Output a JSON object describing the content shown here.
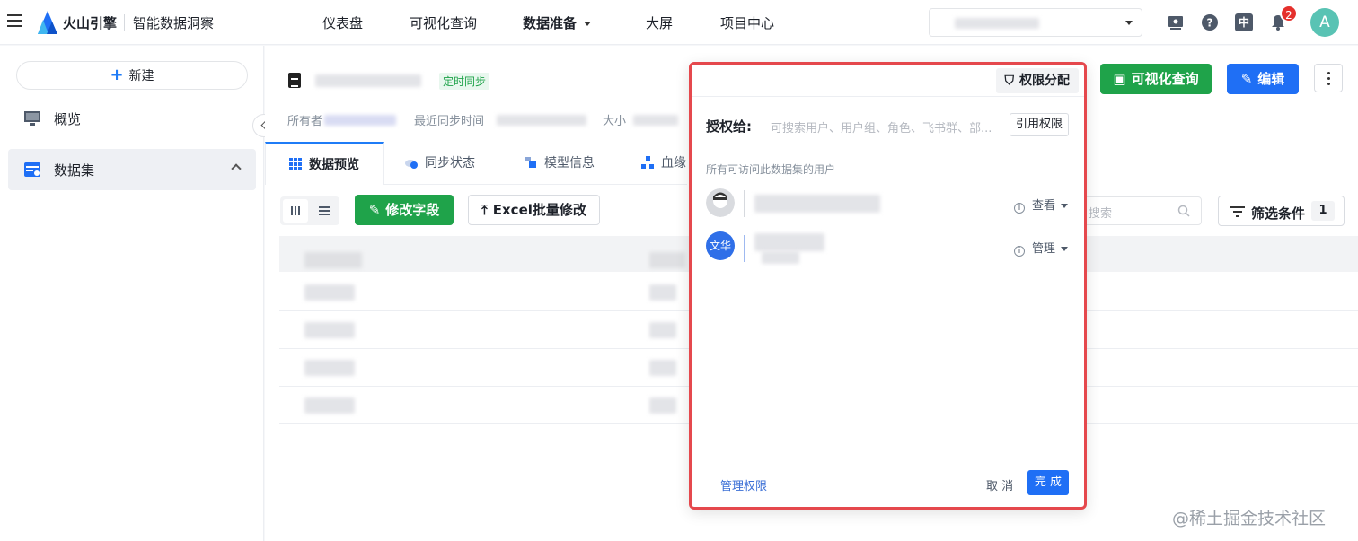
{
  "header": {
    "brand": "火山引擎",
    "product": "智能数据洞察",
    "nav": [
      {
        "label": "仪表盘"
      },
      {
        "label": "可视化查询"
      },
      {
        "label": "数据准备"
      },
      {
        "label": "大屏"
      },
      {
        "label": "项目中心"
      }
    ],
    "notification_count": "2",
    "language": "中",
    "avatar_letter": "A"
  },
  "sidebar": {
    "new_label": "新建",
    "items": [
      {
        "label": "概览"
      },
      {
        "label": "数据集"
      }
    ]
  },
  "dataset": {
    "sync_tag": "定时同步",
    "meta_owner_label": "所有者",
    "meta_last_sync_label": "最近同步时间",
    "meta_size_label": "大小"
  },
  "tabs": [
    {
      "label": "数据预览"
    },
    {
      "label": "同步状态"
    },
    {
      "label": "模型信息"
    },
    {
      "label": "血缘"
    }
  ],
  "toolbar": {
    "edit_fields": "修改字段",
    "excel_batch": "Excel批量修改",
    "search_placeholder": "搜索",
    "filter_label": "筛选条件",
    "filter_count": "1",
    "visual_query_btn": "可视化查询",
    "edit_btn": "编辑"
  },
  "modal": {
    "title_tag": "权限分配",
    "grant_label": "授权给:",
    "grant_placeholder": "可搜索用户、用户组、角色、飞书群、部...",
    "quote_btn": "引用权限",
    "users_title": "所有可访问此数据集的用户",
    "users": [
      {
        "role": "查看"
      },
      {
        "avatar_text": "文华",
        "role": "管理"
      }
    ],
    "manage_link": "管理权限",
    "cancel": "取 消",
    "done": "完 成"
  },
  "watermark": "@稀土掘金技术社区",
  "colors": {
    "accent_blue": "#1f6ff5",
    "green": "#1fa34a",
    "highlight_red": "#e5484d",
    "badge_red": "#e5302c"
  }
}
